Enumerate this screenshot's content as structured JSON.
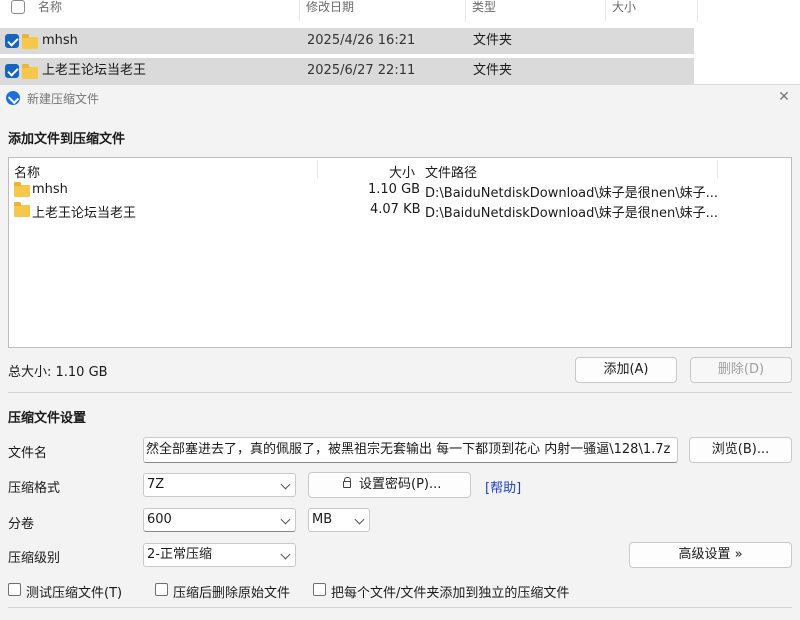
{
  "explorer": {
    "columns": [
      "名称",
      "修改日期",
      "类型",
      "大小"
    ],
    "rows": [
      {
        "name": "mhsh",
        "date": "2025/4/26 16:21",
        "type": "文件夹"
      },
      {
        "name": "上老王论坛当老王",
        "date": "2025/6/27 22:11",
        "type": "文件夹"
      }
    ]
  },
  "dialog": {
    "title": "新建压缩文件",
    "section_add": "添加文件到压缩文件",
    "file_list": {
      "headers": {
        "name": "名称",
        "size": "大小",
        "path": "文件路径"
      },
      "rows": [
        {
          "name": "mhsh",
          "size": "1.10 GB",
          "path": "D:\\BaiduNetdiskDownload\\妹子是很nen\\妹子..."
        },
        {
          "name": "上老王论坛当老王",
          "size": "4.07 KB",
          "path": "D:\\BaiduNetdiskDownload\\妹子是很nen\\妹子..."
        }
      ]
    },
    "total_size": "总大小: 1.10 GB",
    "add_button": "添加(A)",
    "delete_button": "删除(D)",
    "section_settings": "压缩文件设置",
    "filename_label": "文件名",
    "filename_value": "然全部塞进去了，真的佩服了，被黑祖宗无套输出 每一下都顶到花心 内射一骚逼\\128\\1.7z",
    "browse_button": "浏览(B)...",
    "format_label": "压缩格式",
    "format_value": "7Z",
    "password_button": "设置密码(P)...",
    "help_link": "[帮助]",
    "volume_label": "分卷",
    "volume_value": "600",
    "volume_unit": "MB",
    "level_label": "压缩级别",
    "level_value": "2-正常压缩",
    "advanced_button": "高级设置 »",
    "checkboxes": [
      {
        "label": "测试压缩文件(T)",
        "checked": false
      },
      {
        "label": "压缩后删除原始文件",
        "checked": false
      },
      {
        "label": "把每个文件/文件夹添加到独立的压缩文件",
        "checked": false
      }
    ]
  },
  "colors": {
    "accent": "#1565c0",
    "selected_row": "#dadada",
    "dialog_bg": "#f3f3f3",
    "folder": "#f7c74a",
    "link": "#1f3fbf"
  }
}
